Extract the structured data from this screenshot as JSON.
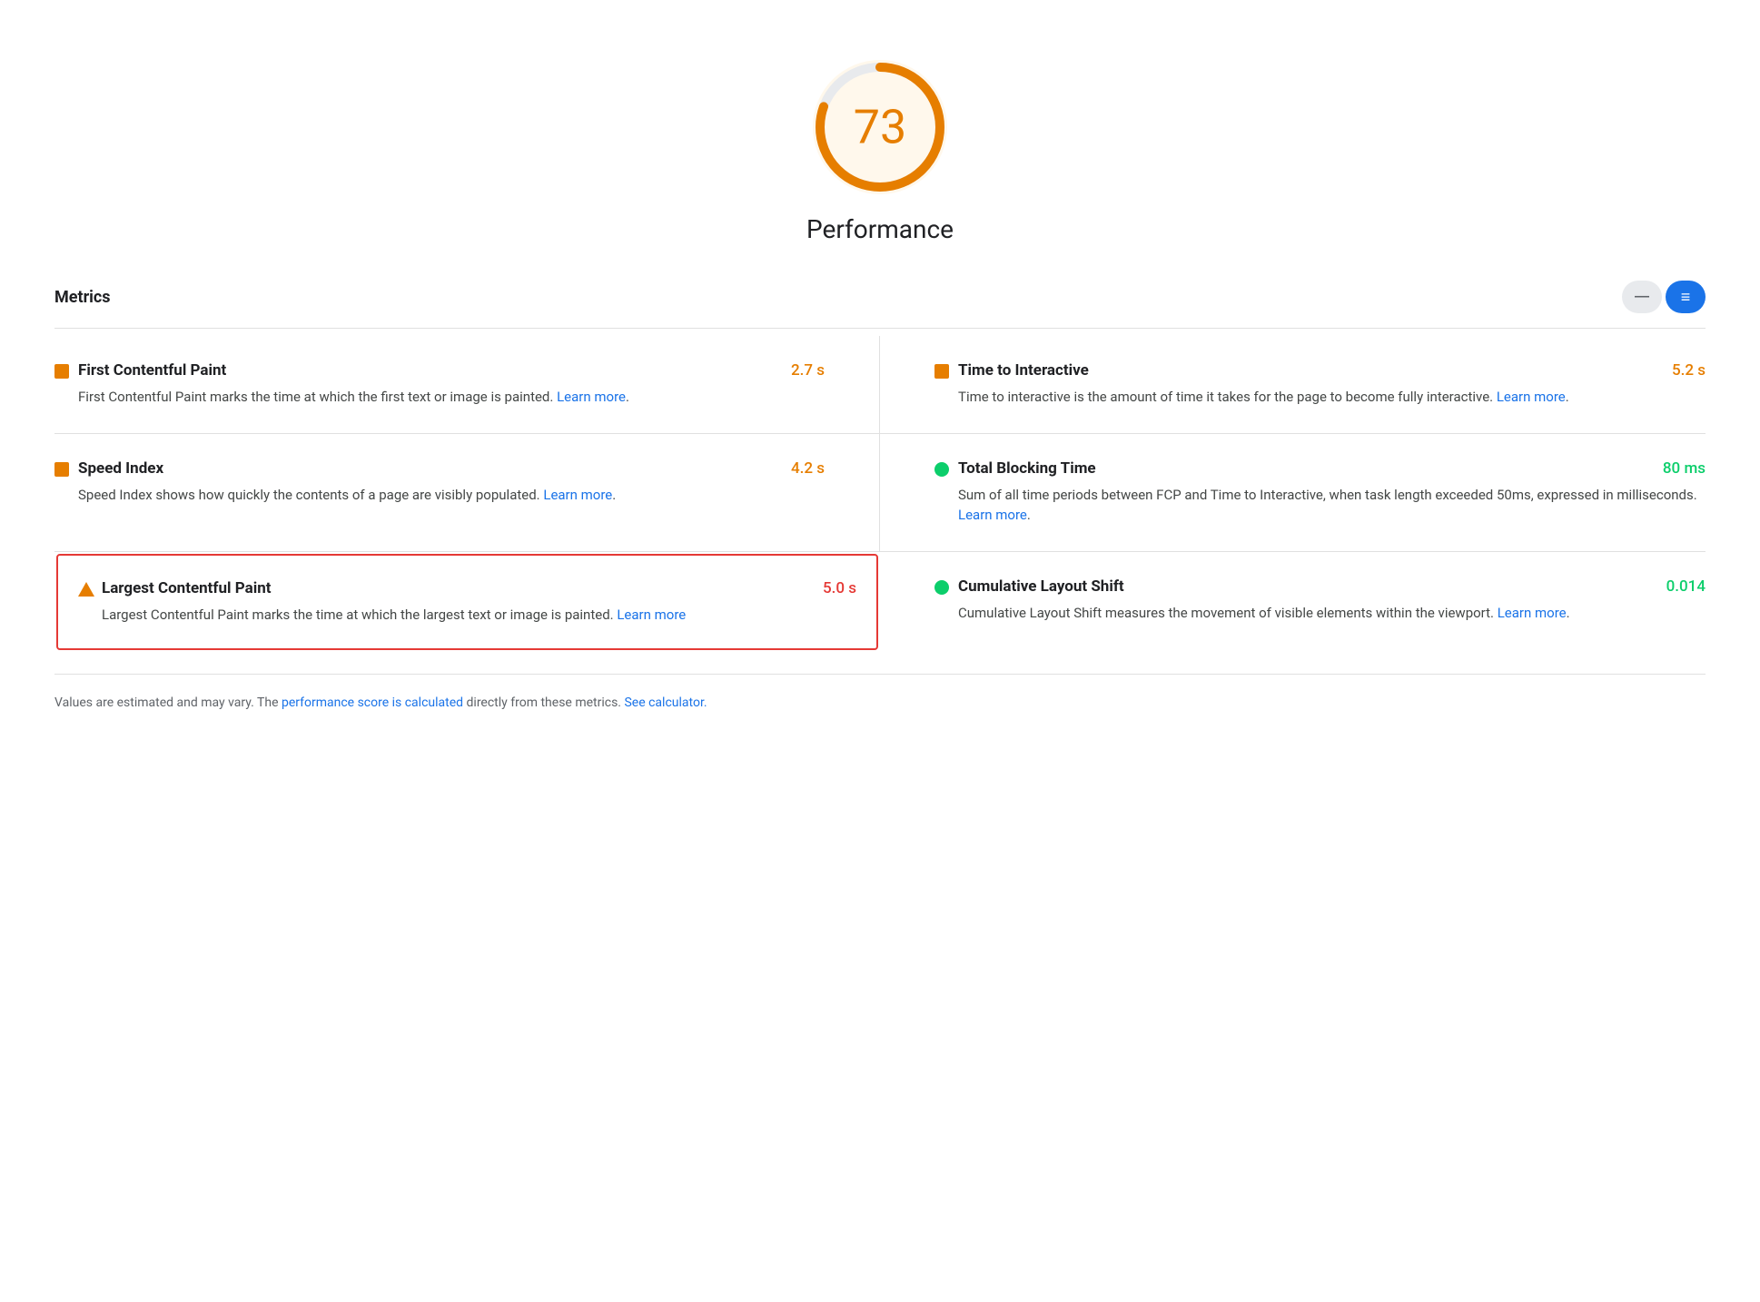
{
  "score": {
    "value": "73",
    "label": "Performance",
    "color": "#e67e00",
    "bg_color": "#fff8ec"
  },
  "metrics_section": {
    "title": "Metrics"
  },
  "toggle": {
    "list_label": "—",
    "grid_label": "≡"
  },
  "metrics": [
    {
      "id": "fcp",
      "icon_type": "orange-square",
      "name": "First Contentful Paint",
      "value": "2.7 s",
      "value_color": "value-orange",
      "description": "First Contentful Paint marks the time at which the first text or image is painted.",
      "learn_more_text": "Learn more",
      "learn_more_href": "#",
      "highlighted": false,
      "position": "left"
    },
    {
      "id": "tti",
      "icon_type": "orange-square",
      "name": "Time to Interactive",
      "value": "5.2 s",
      "value_color": "value-orange",
      "description": "Time to interactive is the amount of time it takes for the page to become fully interactive.",
      "learn_more_text": "Learn more",
      "learn_more_href": "#",
      "highlighted": false,
      "position": "right"
    },
    {
      "id": "si",
      "icon_type": "orange-square",
      "name": "Speed Index",
      "value": "4.2 s",
      "value_color": "value-orange",
      "description": "Speed Index shows how quickly the contents of a page are visibly populated.",
      "learn_more_text": "Learn more",
      "learn_more_href": "#",
      "highlighted": false,
      "position": "left"
    },
    {
      "id": "tbt",
      "icon_type": "green-circle",
      "name": "Total Blocking Time",
      "value": "80 ms",
      "value_color": "value-green",
      "description": "Sum of all time periods between FCP and Time to Interactive, when task length exceeded 50ms, expressed in milliseconds.",
      "learn_more_text": "Learn more",
      "learn_more_href": "#",
      "highlighted": false,
      "position": "right"
    },
    {
      "id": "lcp",
      "icon_type": "orange-triangle",
      "name": "Largest Contentful Paint",
      "value": "5.0 s",
      "value_color": "value-red",
      "description": "Largest Contentful Paint marks the time at which the largest text or image is painted.",
      "learn_more_text": "Learn more",
      "learn_more_href": "#",
      "highlighted": true,
      "position": "left"
    },
    {
      "id": "cls",
      "icon_type": "green-circle",
      "name": "Cumulative Layout Shift",
      "value": "0.014",
      "value_color": "value-green",
      "description": "Cumulative Layout Shift measures the movement of visible elements within the viewport.",
      "learn_more_text": "Learn more",
      "learn_more_href": "#",
      "highlighted": false,
      "position": "right"
    }
  ],
  "footer": {
    "text_before": "Values are estimated and may vary. The ",
    "link1_text": "performance score is calculated",
    "link1_href": "#",
    "text_middle": " directly from these metrics. ",
    "link2_text": "See calculator.",
    "link2_href": "#"
  }
}
